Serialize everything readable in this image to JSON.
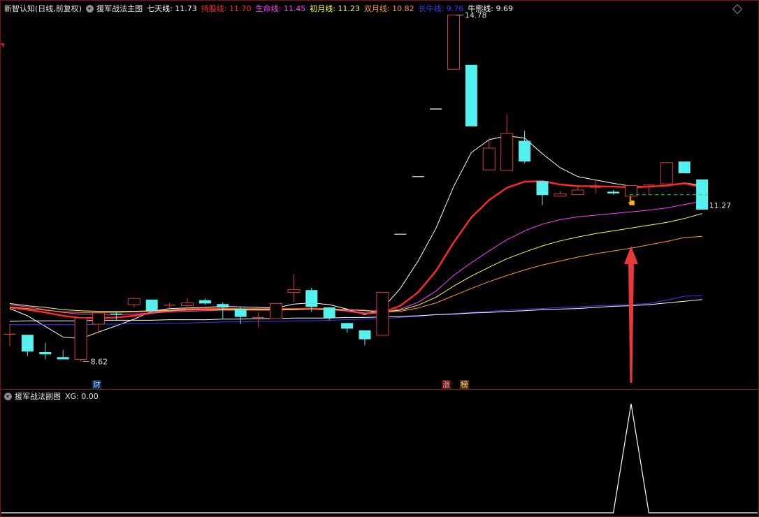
{
  "main_header": {
    "title": "新智认知(日线,前复权)",
    "indicator_name": "援军战法主图",
    "lines": [
      {
        "label": "七天线: 11.73",
        "color": "#ffffff"
      },
      {
        "label": "持股线: 11.70",
        "color": "#ff2a2a"
      },
      {
        "label": "生命线: 11.45",
        "color": "#ff40ff"
      },
      {
        "label": "初月线: 11.23",
        "color": "#ffff40"
      },
      {
        "label": "双月线: 10.82",
        "color": "#ff9a2a"
      },
      {
        "label": "长牛线: 9.76",
        "color": "#3a3aff"
      },
      {
        "label": "牛熊线: 9.69",
        "color": "#ffffff"
      }
    ]
  },
  "sub_header": {
    "indicator_name": "援军战法副图",
    "value_label": "XG: 0.00"
  },
  "badges": {
    "cai": "财",
    "zhang": "涨",
    "bang": "榜"
  },
  "price_labels": {
    "high": "14.78",
    "low": "8.62",
    "last": "11.27"
  },
  "colors": {
    "up": "#d93a3a",
    "down": "#55f0f0",
    "arrow": "#e83838",
    "frame": "#7a1414"
  },
  "icons": [
    "chevron-circle-icon",
    "diamond-icon",
    "hand-pointer-icon",
    "up-arrow-icon"
  ],
  "chart_data": {
    "type": "candlestick",
    "price_range": [
      8.2,
      14.95
    ],
    "candles": [
      {
        "o": 9.07,
        "h": 9.25,
        "l": 8.86,
        "c": 9.07
      },
      {
        "o": 9.06,
        "h": 9.06,
        "l": 8.68,
        "c": 8.76
      },
      {
        "o": 8.75,
        "h": 8.92,
        "l": 8.62,
        "c": 8.71
      },
      {
        "o": 8.66,
        "h": 8.79,
        "l": 8.63,
        "c": 8.62
      },
      {
        "o": 8.62,
        "h": 9.36,
        "l": 8.58,
        "c": 9.36
      },
      {
        "o": 9.25,
        "h": 9.45,
        "l": 9.08,
        "c": 9.45
      },
      {
        "o": 9.44,
        "h": 9.47,
        "l": 9.33,
        "c": 9.42
      },
      {
        "o": 9.6,
        "h": 9.73,
        "l": 9.55,
        "c": 9.71
      },
      {
        "o": 9.69,
        "h": 9.69,
        "l": 9.46,
        "c": 9.49
      },
      {
        "o": 9.59,
        "h": 9.63,
        "l": 9.5,
        "c": 9.59
      },
      {
        "o": 9.58,
        "h": 9.72,
        "l": 9.5,
        "c": 9.63
      },
      {
        "o": 9.68,
        "h": 9.71,
        "l": 9.6,
        "c": 9.62
      },
      {
        "o": 9.61,
        "h": 9.64,
        "l": 9.35,
        "c": 9.55
      },
      {
        "o": 9.52,
        "h": 9.55,
        "l": 9.25,
        "c": 9.38
      },
      {
        "o": 9.37,
        "h": 9.46,
        "l": 9.19,
        "c": 9.37
      },
      {
        "o": 9.35,
        "h": 9.62,
        "l": 9.35,
        "c": 9.62
      },
      {
        "o": 9.82,
        "h": 10.15,
        "l": 9.65,
        "c": 9.87
      },
      {
        "o": 9.86,
        "h": 9.9,
        "l": 9.47,
        "c": 9.56
      },
      {
        "o": 9.55,
        "h": 9.55,
        "l": 9.32,
        "c": 9.36
      },
      {
        "o": 9.27,
        "h": 9.27,
        "l": 9.1,
        "c": 9.17
      },
      {
        "o": 9.14,
        "h": 9.14,
        "l": 8.87,
        "c": 8.98
      },
      {
        "o": 9.05,
        "h": 9.82,
        "l": 9.05,
        "c": 9.82
      },
      {
        "o": 10.86,
        "h": 10.86,
        "l": 10.86,
        "c": 10.86
      },
      {
        "o": 11.89,
        "h": 11.89,
        "l": 11.89,
        "c": 11.89
      },
      {
        "o": 13.1,
        "h": 13.1,
        "l": 13.1,
        "c": 13.1
      },
      {
        "o": 13.81,
        "h": 14.78,
        "l": 13.81,
        "c": 14.78
      },
      {
        "o": 13.89,
        "h": 13.89,
        "l": 12.79,
        "c": 12.79
      },
      {
        "o": 12.01,
        "h": 12.58,
        "l": 12.01,
        "c": 12.4
      },
      {
        "o": 12.0,
        "h": 13.0,
        "l": 12.0,
        "c": 12.66
      },
      {
        "o": 12.53,
        "h": 12.71,
        "l": 12.13,
        "c": 12.16
      },
      {
        "o": 11.81,
        "h": 11.81,
        "l": 11.38,
        "c": 11.56
      },
      {
        "o": 11.54,
        "h": 11.63,
        "l": 11.54,
        "c": 11.58
      },
      {
        "o": 11.57,
        "h": 11.71,
        "l": 11.57,
        "c": 11.65
      },
      {
        "o": 11.7,
        "h": 11.82,
        "l": 11.59,
        "c": 11.7
      },
      {
        "o": 11.62,
        "h": 11.65,
        "l": 11.57,
        "c": 11.59
      },
      {
        "o": 11.54,
        "h": 11.73,
        "l": 11.54,
        "c": 11.73
      },
      {
        "o": 11.74,
        "h": 11.74,
        "l": 11.57,
        "c": 11.74
      },
      {
        "o": 11.76,
        "h": 12.15,
        "l": 11.76,
        "c": 12.14
      },
      {
        "o": 12.16,
        "h": 12.16,
        "l": 11.95,
        "c": 11.95
      },
      {
        "o": 11.84,
        "h": 11.84,
        "l": 11.3,
        "c": 11.3
      }
    ],
    "series": [
      {
        "name": "七天线",
        "color": "#ffffff",
        "width": 1,
        "values": [
          9.53,
          9.4,
          9.21,
          9.02,
          8.99,
          9.11,
          9.22,
          9.34,
          9.48,
          9.53,
          9.54,
          9.55,
          9.57,
          9.56,
          9.55,
          9.54,
          9.61,
          9.63,
          9.6,
          9.52,
          9.42,
          9.53,
          9.89,
          10.38,
          10.96,
          11.71,
          12.32,
          12.55,
          12.62,
          12.58,
          12.3,
          12.05,
          11.89,
          11.83,
          11.77,
          11.72,
          11.71,
          11.73,
          11.78,
          11.73
        ]
      },
      {
        "name": "持股线",
        "color": "#ff2a2a",
        "width": 2.4,
        "values": [
          9.55,
          9.51,
          9.46,
          9.4,
          9.36,
          9.36,
          9.37,
          9.4,
          9.45,
          9.49,
          9.52,
          9.53,
          9.53,
          9.52,
          9.52,
          9.52,
          9.52,
          9.53,
          9.52,
          9.49,
          9.44,
          9.46,
          9.58,
          9.82,
          10.2,
          10.71,
          11.16,
          11.47,
          11.69,
          11.8,
          11.81,
          11.75,
          11.72,
          11.72,
          11.71,
          11.7,
          11.71,
          11.73,
          11.77,
          11.7
        ]
      },
      {
        "name": "生命线",
        "color": "#ff40ff",
        "width": 1,
        "values": [
          9.6,
          9.56,
          9.51,
          9.46,
          9.43,
          9.43,
          9.42,
          9.43,
          9.45,
          9.47,
          9.48,
          9.49,
          9.5,
          9.5,
          9.5,
          9.5,
          9.51,
          9.52,
          9.51,
          9.49,
          9.45,
          9.46,
          9.52,
          9.64,
          9.84,
          10.12,
          10.35,
          10.56,
          10.76,
          10.92,
          11.04,
          11.12,
          11.17,
          11.2,
          11.23,
          11.26,
          11.29,
          11.33,
          11.39,
          11.45
        ]
      },
      {
        "name": "初月线",
        "color": "#ffff40",
        "width": 1,
        "values": [
          9.62,
          9.58,
          9.55,
          9.51,
          9.49,
          9.48,
          9.48,
          9.48,
          9.49,
          9.5,
          9.51,
          9.51,
          9.52,
          9.52,
          9.52,
          9.52,
          9.52,
          9.52,
          9.52,
          9.51,
          9.49,
          9.47,
          9.5,
          9.59,
          9.73,
          9.93,
          10.11,
          10.27,
          10.42,
          10.54,
          10.65,
          10.74,
          10.81,
          10.87,
          10.92,
          10.97,
          11.02,
          11.07,
          11.14,
          11.23
        ]
      },
      {
        "name": "双月线",
        "color": "#ff9a2a",
        "width": 1,
        "values": [
          9.56,
          9.53,
          9.5,
          9.47,
          9.46,
          9.46,
          9.46,
          9.47,
          9.48,
          9.49,
          9.5,
          9.51,
          9.51,
          9.51,
          9.51,
          9.51,
          9.51,
          9.52,
          9.51,
          9.51,
          9.5,
          9.47,
          9.48,
          9.54,
          9.63,
          9.76,
          9.89,
          10.01,
          10.12,
          10.22,
          10.31,
          10.38,
          10.45,
          10.51,
          10.56,
          10.61,
          10.67,
          10.73,
          10.8,
          10.82
        ]
      },
      {
        "name": "长牛线",
        "color": "#3a3aff",
        "width": 1,
        "values": [
          9.24,
          9.24,
          9.24,
          9.24,
          9.24,
          9.25,
          9.25,
          9.26,
          9.26,
          9.27,
          9.27,
          9.28,
          9.29,
          9.29,
          9.3,
          9.3,
          9.31,
          9.31,
          9.32,
          9.33,
          9.34,
          9.35,
          9.37,
          9.39,
          9.42,
          9.44,
          9.46,
          9.48,
          9.5,
          9.52,
          9.53,
          9.55,
          9.56,
          9.58,
          9.59,
          9.6,
          9.62,
          9.68,
          9.75,
          9.76
        ]
      },
      {
        "name": "牛熊线",
        "color": "#ffffff",
        "width": 1,
        "values": [
          9.3,
          9.31,
          9.31,
          9.31,
          9.31,
          9.32,
          9.32,
          9.32,
          9.32,
          9.33,
          9.33,
          9.33,
          9.34,
          9.34,
          9.35,
          9.35,
          9.36,
          9.36,
          9.36,
          9.37,
          9.37,
          9.38,
          9.39,
          9.4,
          9.42,
          9.43,
          9.45,
          9.46,
          9.48,
          9.49,
          9.51,
          9.52,
          9.53,
          9.55,
          9.57,
          9.58,
          9.6,
          9.63,
          9.66,
          9.69
        ]
      }
    ],
    "sub_series": {
      "name": "XG",
      "color": "#ffffff",
      "range": [
        0,
        1
      ],
      "values": [
        0,
        0,
        0,
        0,
        0,
        0,
        0,
        0,
        0,
        0,
        0,
        0,
        0,
        0,
        0,
        0,
        0,
        0,
        0,
        0,
        0,
        0,
        0,
        0,
        0,
        0,
        0,
        0,
        0,
        0,
        0,
        0,
        0,
        0,
        0,
        1,
        0,
        0,
        0,
        0
      ]
    },
    "signal_index": 35
  }
}
